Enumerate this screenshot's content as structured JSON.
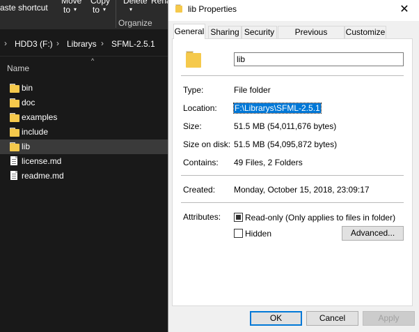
{
  "explorer": {
    "ribbon": {
      "paste_shortcut": "aste shortcut",
      "move_to": [
        "Move",
        "to"
      ],
      "copy_to": [
        "Copy",
        "to"
      ],
      "delete": "Delete",
      "rename": "Rena",
      "group_label": "Organize"
    },
    "breadcrumb": [
      "HDD3 (F:)",
      "Librarys",
      "SFML-2.5.1"
    ],
    "column_header": "Name",
    "items": [
      {
        "name": "bin",
        "type": "folder"
      },
      {
        "name": "doc",
        "type": "folder"
      },
      {
        "name": "examples",
        "type": "folder"
      },
      {
        "name": "include",
        "type": "folder"
      },
      {
        "name": "lib",
        "type": "folder",
        "selected": true
      },
      {
        "name": "license.md",
        "type": "file"
      },
      {
        "name": "readme.md",
        "type": "file"
      }
    ]
  },
  "dialog": {
    "title": "lib Properties",
    "close_glyph": "✕",
    "tabs": [
      "General",
      "Sharing",
      "Security",
      "Previous Versions",
      "Customize"
    ],
    "active_tab": "General",
    "name_value": "lib",
    "props": {
      "type_label": "Type:",
      "type_value": "File folder",
      "location_label": "Location:",
      "location_value": "F:\\Librarys\\SFML-2.5.1",
      "size_label": "Size:",
      "size_value": "51.5 MB (54,011,676 bytes)",
      "size_on_disk_label": "Size on disk:",
      "size_on_disk_value": "51.5 MB (54,095,872 bytes)",
      "contains_label": "Contains:",
      "contains_value": "49 Files, 2 Folders",
      "created_label": "Created:",
      "created_value": "Monday, October 15, 2018, 23:09:17",
      "attributes_label": "Attributes:",
      "readonly_label": "Read-only (Only applies to files in folder)",
      "hidden_label": "Hidden",
      "advanced_label": "Advanced..."
    },
    "buttons": {
      "ok": "OK",
      "cancel": "Cancel",
      "apply": "Apply"
    }
  },
  "colors": {
    "explorer_bg": "#191919",
    "selection": "#0078d7",
    "folder": "#f5c94c"
  }
}
